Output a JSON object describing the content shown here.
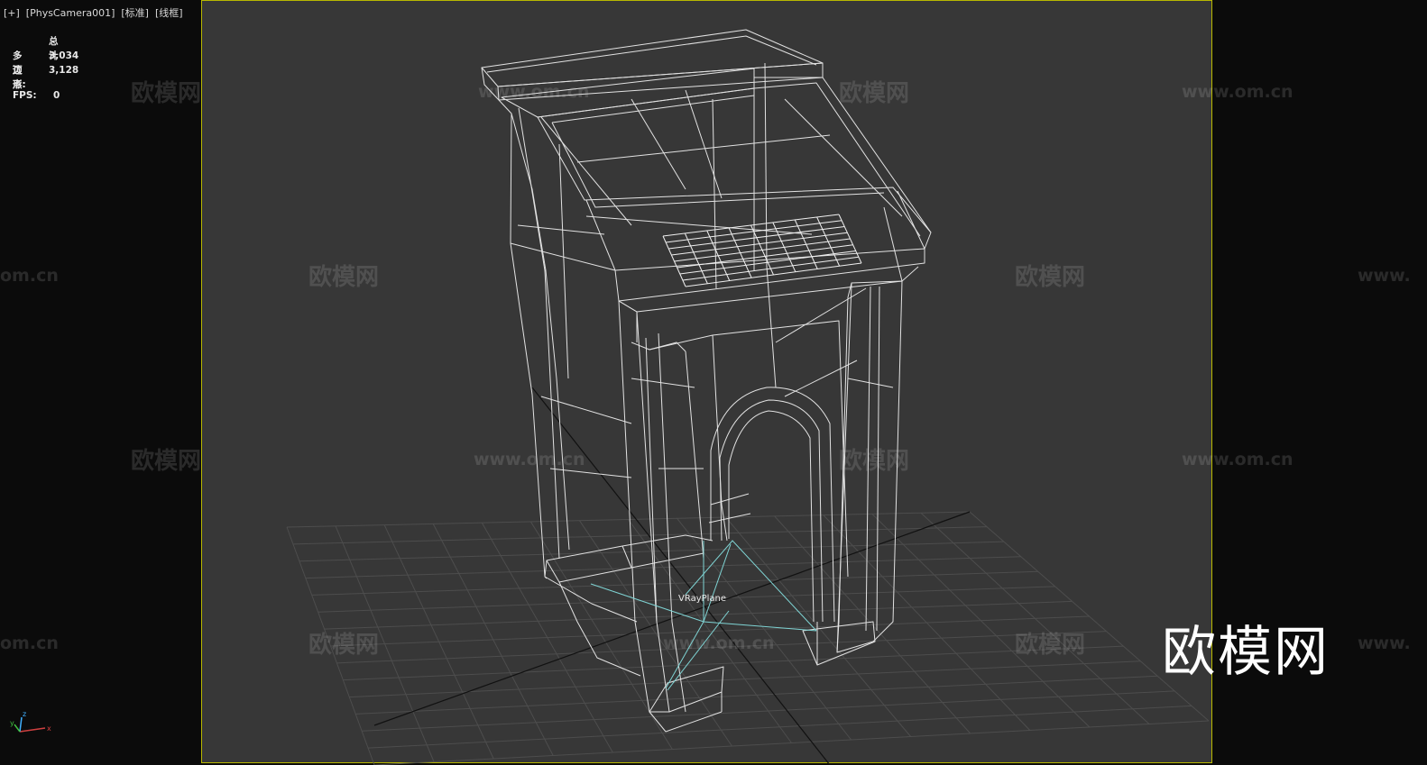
{
  "viewport": {
    "label": "[+]  [PhysCamera001]  [标准]  [线框]",
    "stats": {
      "header": "总计",
      "polygons_label": "多边形:",
      "polygons_value": "3,034",
      "vertices_label": "顶点:",
      "vertices_value": "3,128",
      "fps_label": "FPS:",
      "fps_value": "0"
    },
    "object_label": "VRayPlane",
    "axis": {
      "z": "z",
      "y": "y",
      "x": "x"
    }
  },
  "watermark": {
    "brand": "欧模网",
    "url": "www.om.cn",
    "url_partial_left": "om.cn",
    "url_partial_right": "www."
  },
  "logo": {
    "text": "欧模网"
  },
  "colors": {
    "viewport_bg": "#373737",
    "outer_bg": "#0b0b0b",
    "frame_border": "#b8b800",
    "wire": "#e0e0e0",
    "vray_plane": "#7fd4d4",
    "grid": "#555555"
  }
}
